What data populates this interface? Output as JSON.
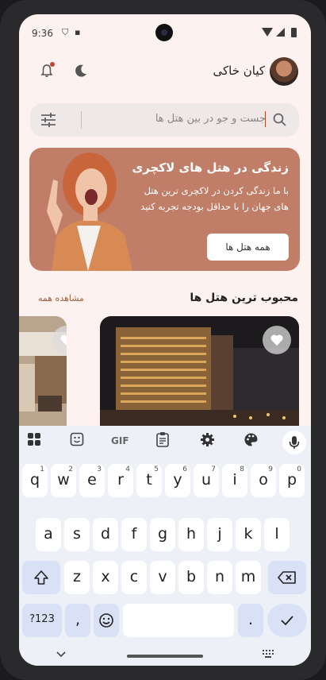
{
  "status_bar": {
    "time": "9:36"
  },
  "header": {
    "user_name": "کیان خاکی"
  },
  "search": {
    "placeholder": "جست و جو در بین هتل ها"
  },
  "banner": {
    "title": "زندگی در هتل های لاکچری",
    "description": "با ما زندگی کردن در لاکچری ترین هتل های جهان را با حداقل بودجه تجربه کنید",
    "button_label": "همه هتل ها"
  },
  "popular": {
    "title": "محبوب ترین هتل ها",
    "see_all_label": "مشاهده همه"
  },
  "keyboard": {
    "toolbar": {
      "gif_label": "GIF"
    },
    "row1": [
      {
        "k": "q",
        "h": "1"
      },
      {
        "k": "w",
        "h": "2"
      },
      {
        "k": "e",
        "h": "3"
      },
      {
        "k": "r",
        "h": "4"
      },
      {
        "k": "t",
        "h": "5"
      },
      {
        "k": "y",
        "h": "6"
      },
      {
        "k": "u",
        "h": "7"
      },
      {
        "k": "i",
        "h": "8"
      },
      {
        "k": "o",
        "h": "9"
      },
      {
        "k": "p",
        "h": "0"
      }
    ],
    "row2": [
      "a",
      "s",
      "d",
      "f",
      "g",
      "h",
      "j",
      "k",
      "l"
    ],
    "row3": [
      "z",
      "x",
      "c",
      "v",
      "b",
      "n",
      "m"
    ],
    "symbols_label": "?123",
    "comma_label": ",",
    "period_label": "."
  }
}
